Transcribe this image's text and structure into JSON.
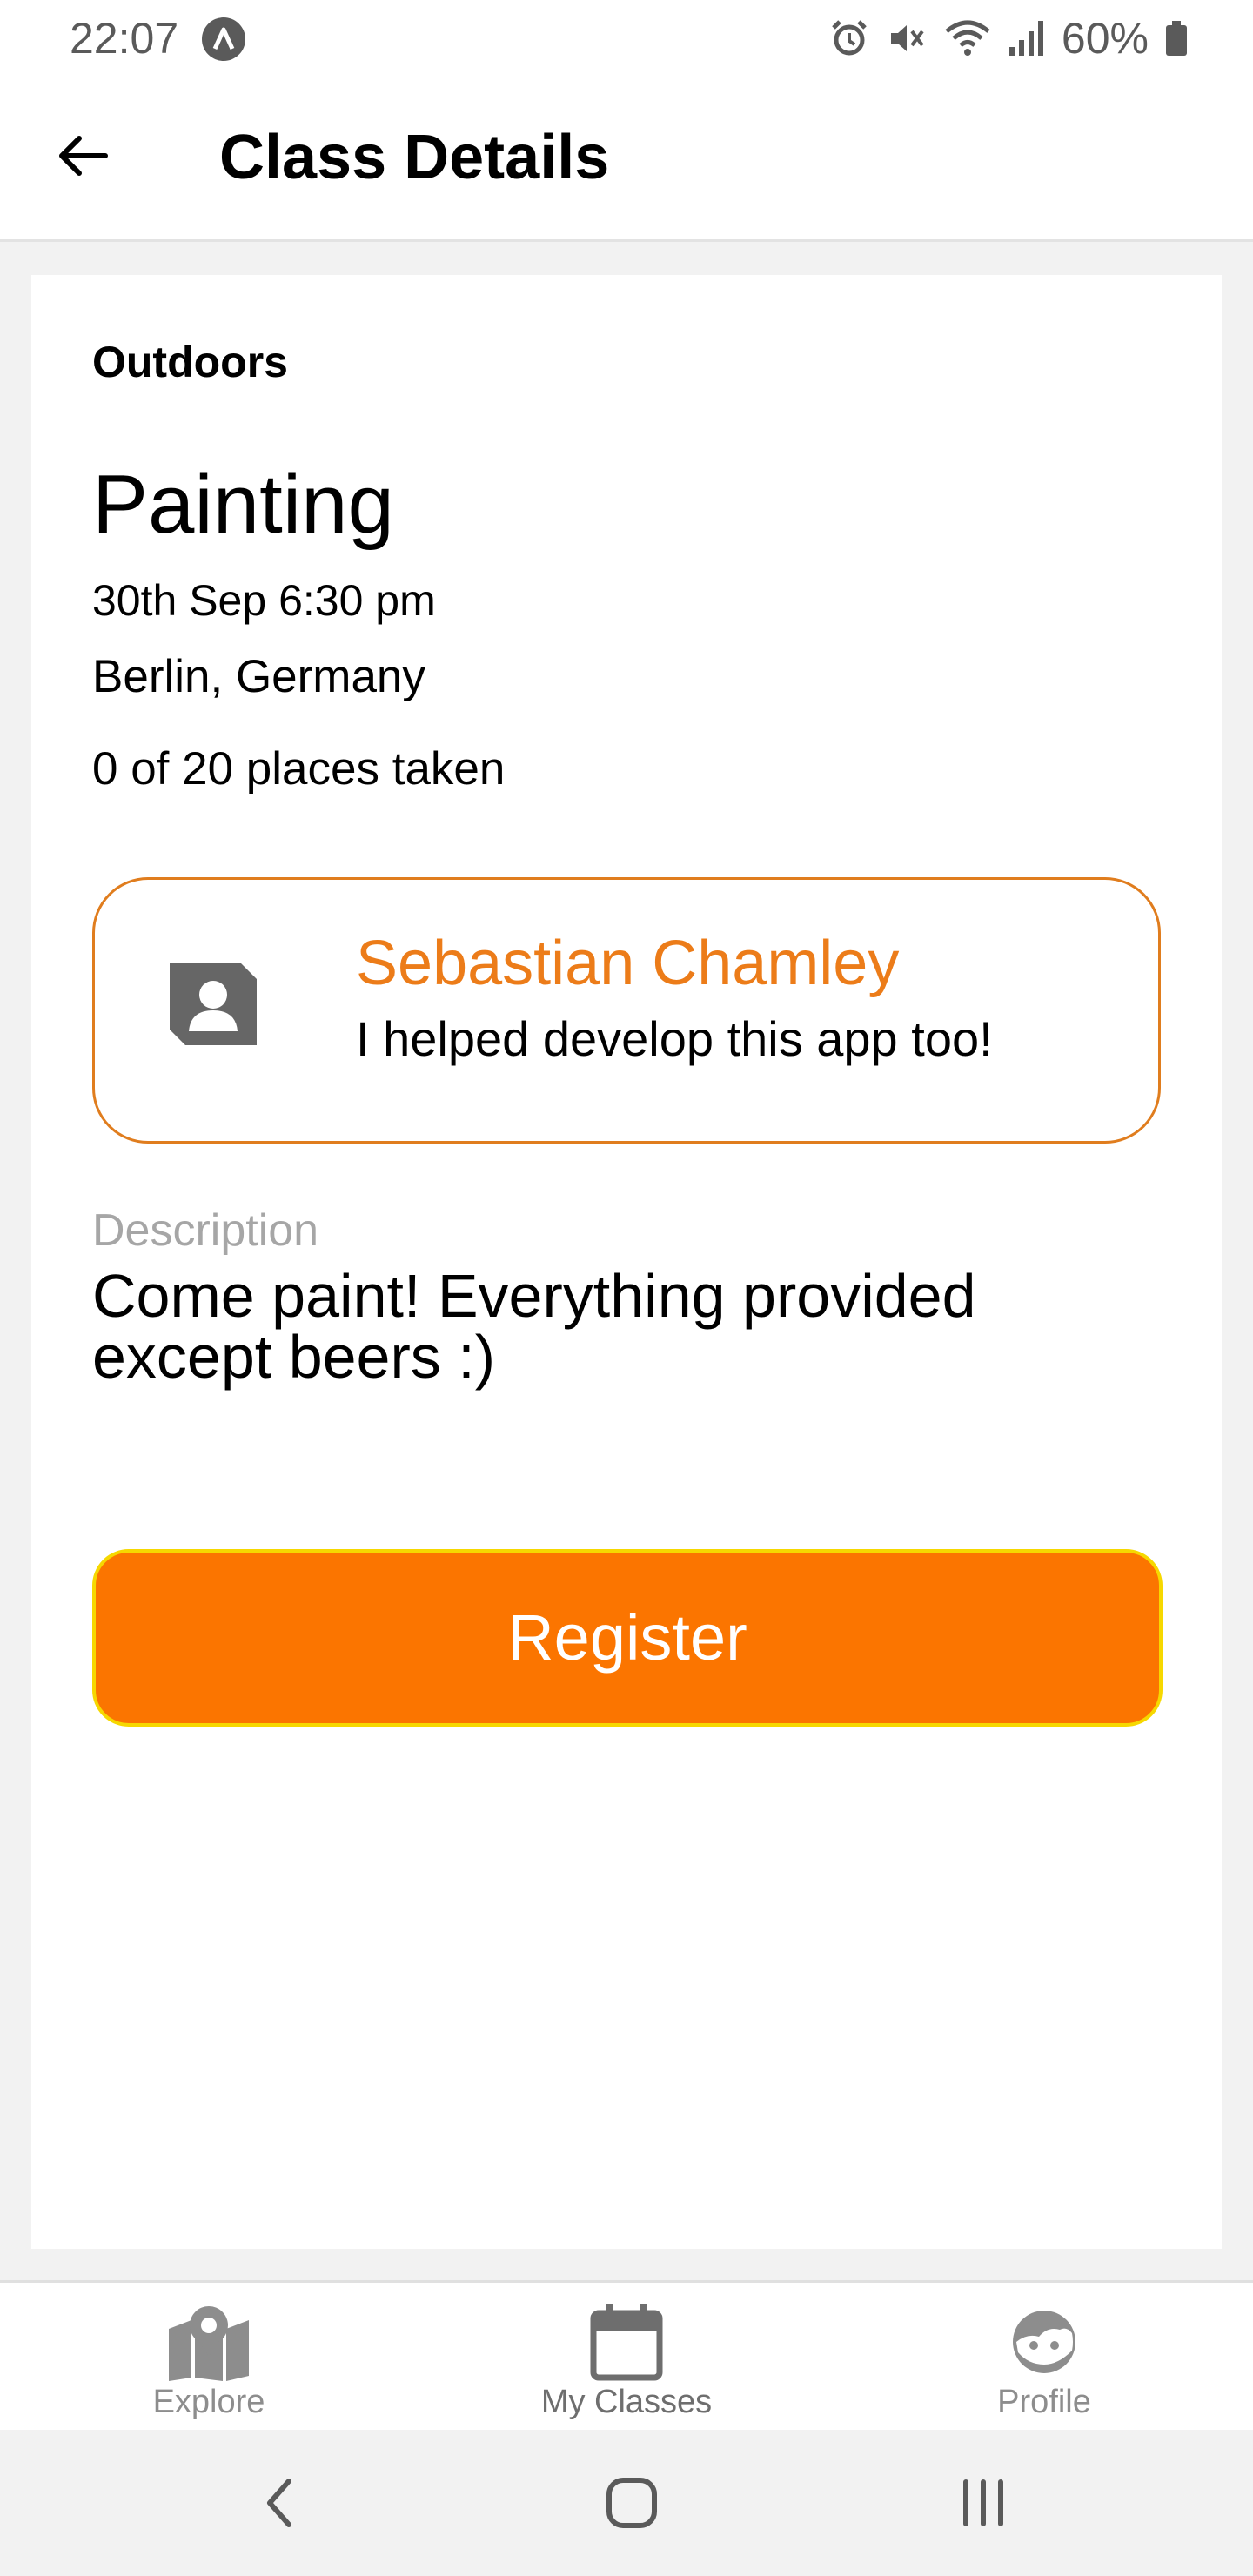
{
  "status_bar": {
    "time": "22:07",
    "battery": "60%",
    "icons": [
      "assistant-icon",
      "alarm-icon",
      "mute-icon",
      "wifi-icon",
      "signal-icon",
      "battery-icon"
    ]
  },
  "app_bar": {
    "title": "Class Details",
    "back_icon": "arrow-left-icon"
  },
  "class_info": {
    "category": "Outdoors",
    "title": "Painting",
    "date": "30th Sep 6:30 pm",
    "location": "Berlin, Germany",
    "places": "0 of 20 places taken"
  },
  "teacher": {
    "name": "Sebastian Chamley",
    "bio": "I helped develop this app too!",
    "avatar_icon": "contact-avatar-icon"
  },
  "description": {
    "label": "Description",
    "text": "Come paint! Everything provided except beers :)"
  },
  "register_button": {
    "label": "Register"
  },
  "bottom_nav": {
    "items": [
      {
        "label": "Explore",
        "icon": "map-icon"
      },
      {
        "label": "My Classes",
        "icon": "calendar-icon"
      },
      {
        "label": "Profile",
        "icon": "face-icon"
      }
    ]
  },
  "colors": {
    "accent": "#FB7500",
    "teacher_name": "#EC7C19",
    "register_border": "#F6D800",
    "muted_text": "#A6A6A6"
  }
}
